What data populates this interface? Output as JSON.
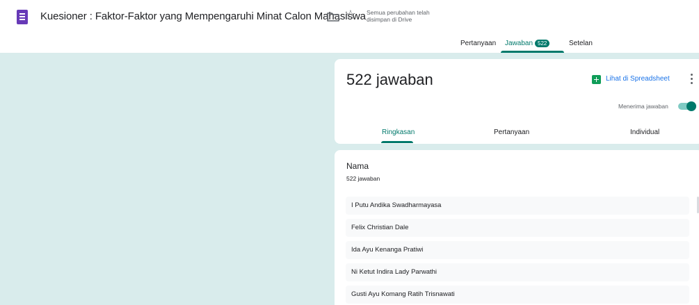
{
  "header": {
    "app_icon": "google-forms-icon",
    "title": "Kuesioner : Faktor-Faktor yang Mempengaruhi Minat Calon Mahasiswa",
    "folder_icon": "folder-icon",
    "star_icon": "star-icon",
    "save_status_line1": "Semua perubahan telah",
    "save_status_line2": "disimpan di Drive"
  },
  "tabs": {
    "questions": "Pertanyaan",
    "responses": "Jawaban",
    "responses_badge": "522",
    "settings": "Setelan",
    "active": "responses"
  },
  "summary": {
    "response_count": "522 jawaban",
    "sheets_link": "Lihat di Spreadsheet",
    "accepting_label": "Menerima jawaban",
    "accepting": true,
    "subtabs": {
      "summary": "Ringkasan",
      "question": "Pertanyaan",
      "individual": "Individual"
    },
    "active_subtab": "summary"
  },
  "question": {
    "title": "Nama",
    "count": "522 jawaban",
    "answers": [
      "I Putu Andika Swadharmayasa",
      "Felix Christian Dale",
      "Ida Ayu Kenanga Pratiwi",
      "Ni Ketut Indira Lady Parwathi",
      "Gusti Ayu Komang Ratih Trisnawati"
    ]
  },
  "colors": {
    "accent": "#00796b",
    "forms_purple": "#673ab7",
    "sheets_green": "#0f9d58",
    "link_blue": "#1a73e8",
    "background": "#d9ecec"
  }
}
